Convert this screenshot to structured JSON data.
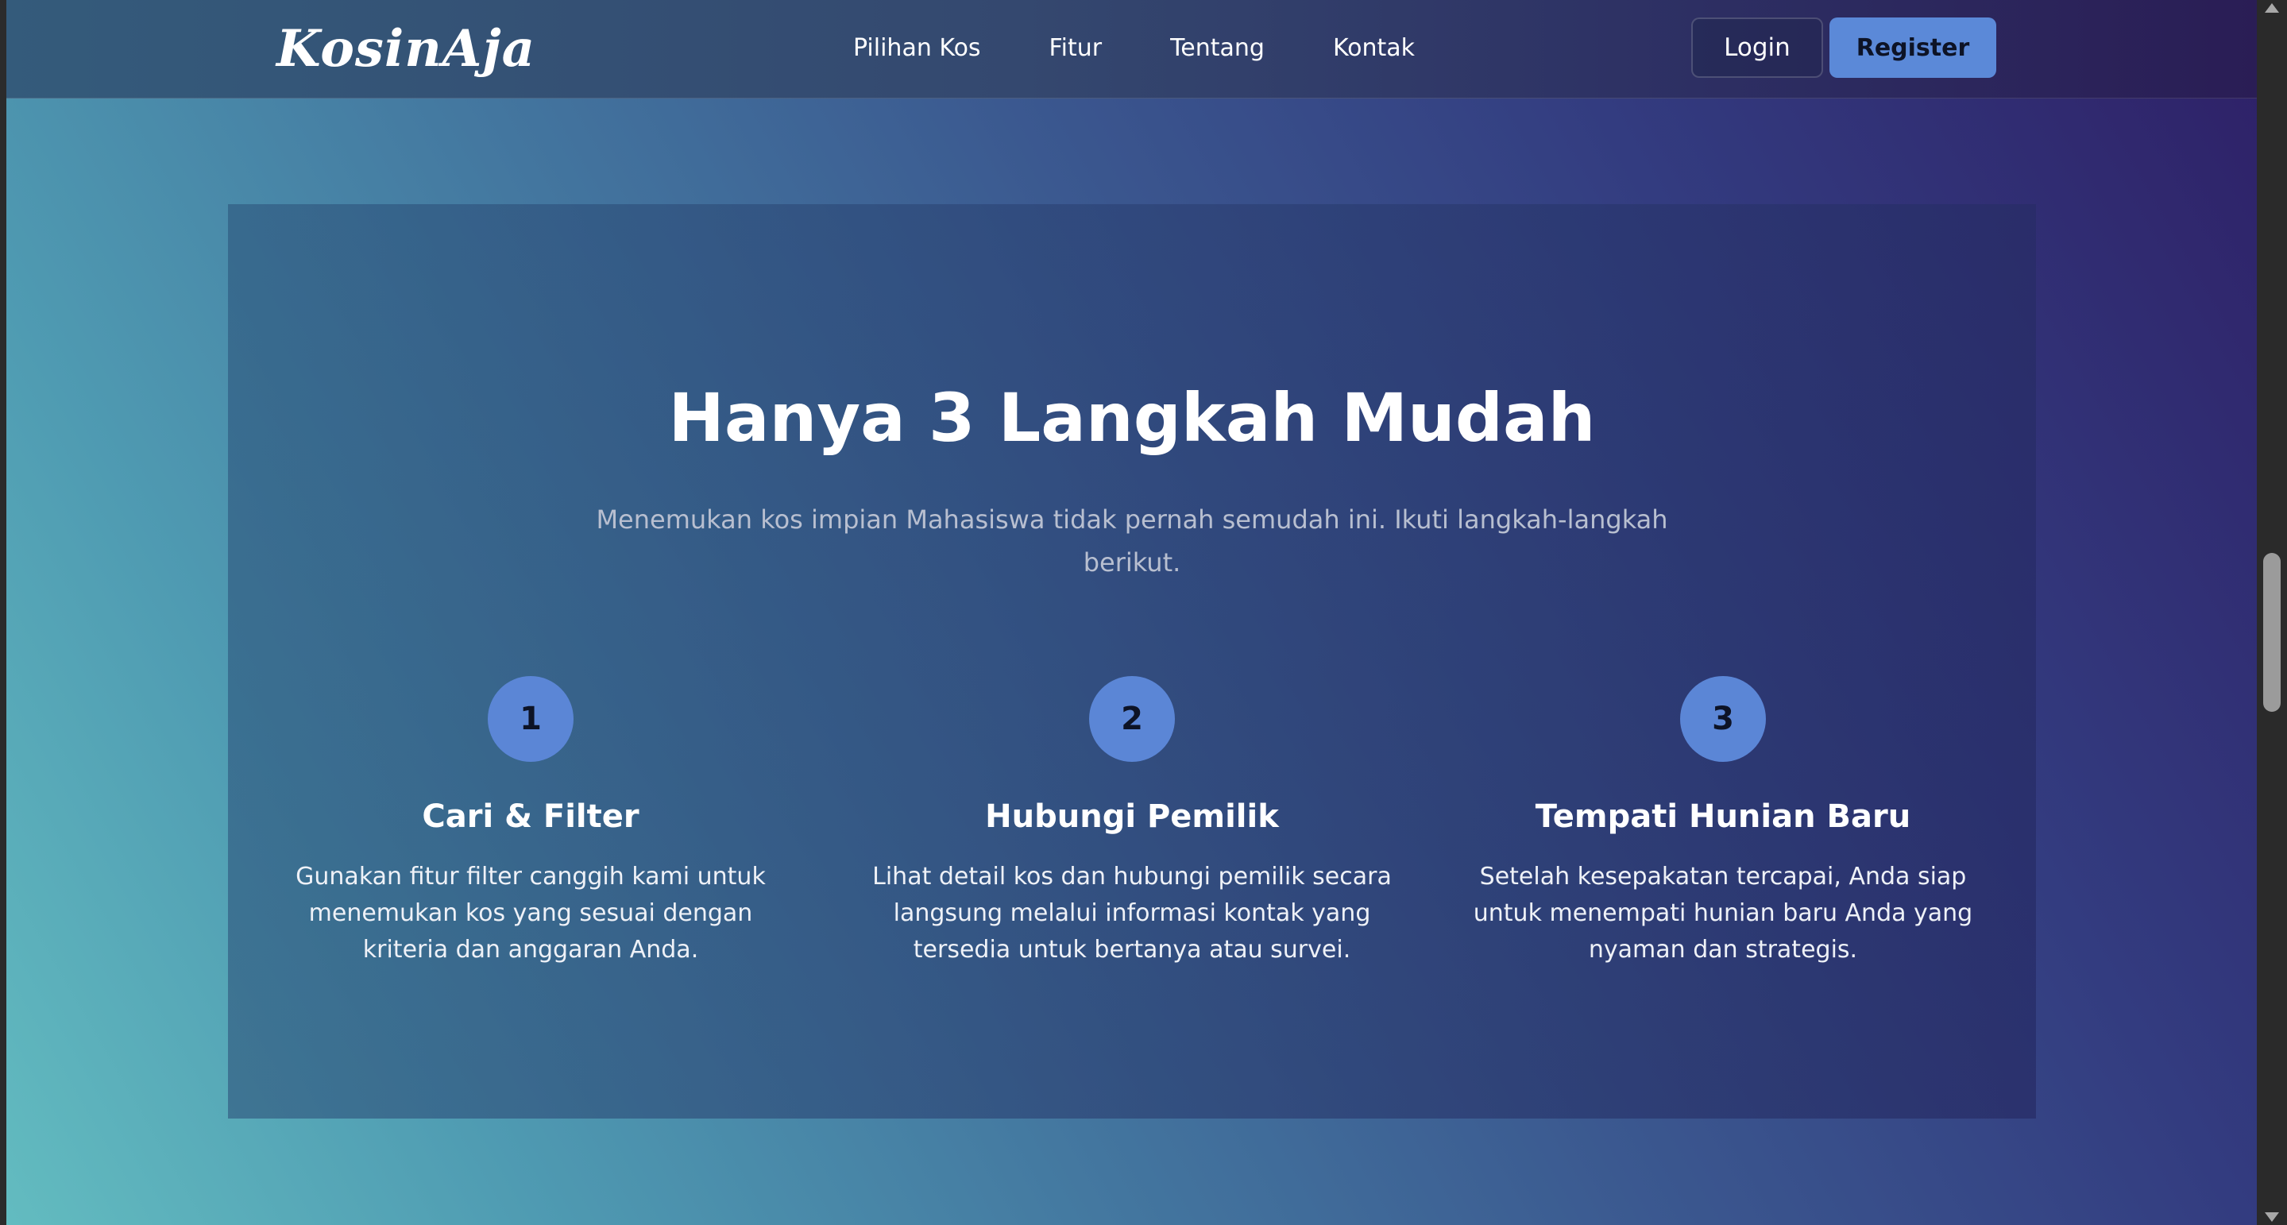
{
  "navbar": {
    "logo": "KosinAja",
    "links": [
      "Pilihan Kos",
      "Fitur",
      "Tentang",
      "Kontak"
    ],
    "login_label": "Login",
    "register_label": "Register"
  },
  "steps_section": {
    "title": "Hanya 3 Langkah Mudah",
    "subtitle": "Menemukan kos impian Mahasiswa tidak pernah semudah ini. Ikuti langkah-langkah berikut.",
    "steps": [
      {
        "number": "1",
        "title": "Cari & Filter",
        "description": "Gunakan fitur filter canggih kami untuk menemukan kos yang sesuai dengan kriteria dan anggaran Anda."
      },
      {
        "number": "2",
        "title": "Hubungi Pemilik",
        "description": "Lihat detail kos dan hubungi pemilik secara langsung melalui informasi kontak yang tersedia untuk bertanya atau survei."
      },
      {
        "number": "3",
        "title": "Tempati Hunian Baru",
        "description": "Setelah kesepakatan tercapai, Anda siap untuk menempati hunian baru Anda yang nyaman dan strategis."
      }
    ]
  },
  "colors": {
    "accent": "#5b89d8",
    "text_primary": "#ffffff",
    "text_muted": "#b8bfd0"
  }
}
